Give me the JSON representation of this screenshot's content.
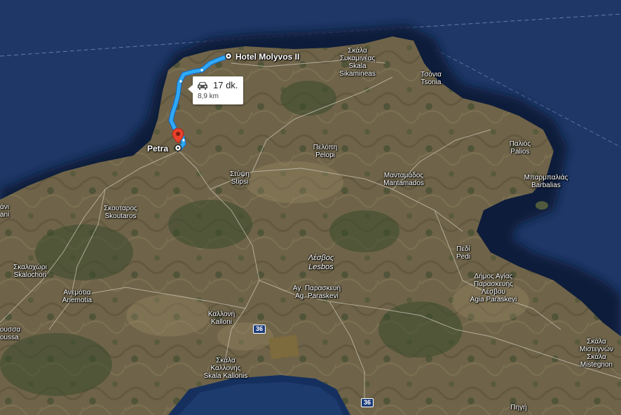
{
  "map": {
    "colors": {
      "sea": "#1e3766",
      "land": "#6e6248",
      "route": "#2fa9f5",
      "marker": "#e8412c"
    },
    "route": {
      "origin": "Hotel Molyvos II",
      "destination": "Petra",
      "duration": "17 dk.",
      "distance": "8,9 km",
      "icon": "car-icon"
    },
    "places": {
      "origin_label": "Hotel Molyvos II",
      "destination_label": "Petra"
    },
    "labels": {
      "skala_sykamineas": [
        "Σκάλα",
        "Συκαμινέας",
        "Skala",
        "Sikamineas"
      ],
      "tsonia": [
        "Τσόνια",
        "Tsonia"
      ],
      "palios": [
        "Παλιός",
        "Palios"
      ],
      "barbalias": [
        "Μπαρμπαλιάς",
        "Barbalias"
      ],
      "pelopi": [
        "Πελόπη",
        "Pelopi"
      ],
      "stipsi": [
        "Στύψη",
        "Stipsi"
      ],
      "mantamados": [
        "Μανταμάδος",
        "Mantamados"
      ],
      "skoutaros": [
        "Σκουταρος",
        "Skoutaros"
      ],
      "skalochori": [
        "Σκαλοχώρι",
        "Skalochori"
      ],
      "anemotia": [
        "Ανεμότια",
        "Anemotia"
      ],
      "lesbos": [
        "Λέσβος",
        "Lesbos"
      ],
      "ag_paraskevi": [
        "Αγ. Παρασκευή",
        "Ag. Paraskevi"
      ],
      "pedi": [
        "Πεδί",
        "Pedi"
      ],
      "dimos_agias": [
        "Δήμος Αγίας",
        "Παρασκευής",
        "Λέσβου",
        "Agia Paraskevi"
      ],
      "kalloni": [
        "Καλλονή",
        "Kalloni"
      ],
      "skala_kallonis": [
        "Σκάλα",
        "Καλλονής",
        "Skala Kallonis"
      ],
      "skala_mistegnon": [
        "Σκάλα",
        "Μιστεγνών",
        "Σκάλα",
        "Mistegnon"
      ],
      "pigi": [
        "Πηγή"
      ],
      "left_edge_1": [
        "άνι",
        "ani"
      ],
      "left_edge_2": [
        "ουσσα",
        "oussa"
      ]
    },
    "roads": {
      "shield_1": "36",
      "shield_2": "36"
    }
  }
}
